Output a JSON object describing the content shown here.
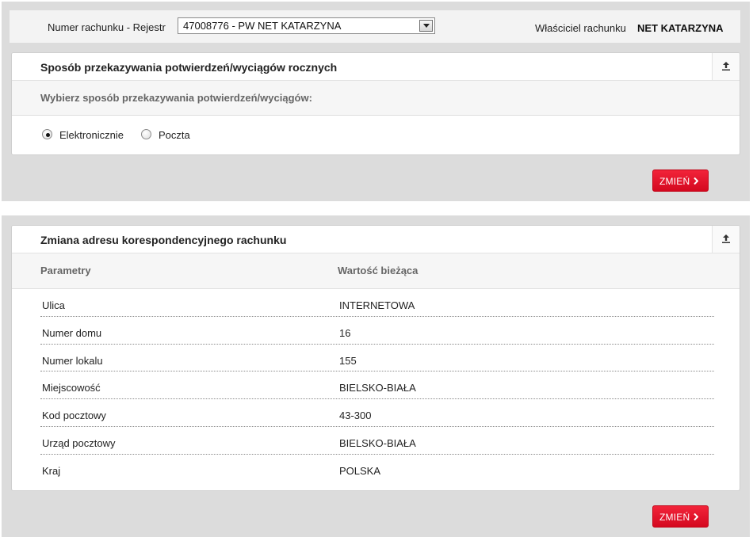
{
  "account_bar": {
    "account_label": "Numer rachunku - Rejestr",
    "account_selected": "47008776 - PW NET KATARZYNA",
    "owner_label": "Właściciel rachunku",
    "owner_value": "NET KATARZYNA"
  },
  "delivery_panel": {
    "title": "Sposób przekazywania potwierdzeń/wyciągów rocznych",
    "subtitle": "Wybierz sposób przekazywania potwierdzeń/wyciągów:",
    "options": [
      {
        "label": "Elektronicznie",
        "selected": true
      },
      {
        "label": "Poczta",
        "selected": false
      }
    ],
    "change_button": "ZMIEŃ"
  },
  "address_panel": {
    "title": "Zmiana adresu korespondencyjnego rachunku",
    "columns": [
      "Parametry",
      "Wartość bieżąca"
    ],
    "rows": [
      {
        "param": "Ulica",
        "value": "INTERNETOWA"
      },
      {
        "param": "Numer domu",
        "value": "16"
      },
      {
        "param": "Numer lokalu",
        "value": "155"
      },
      {
        "param": "Miejscowość",
        "value": "BIELSKO-BIAŁA"
      },
      {
        "param": "Kod pocztowy",
        "value": "43-300"
      },
      {
        "param": "Urząd pocztowy",
        "value": "BIELSKO-BIAŁA"
      },
      {
        "param": "Kraj",
        "value": "POLSKA"
      }
    ],
    "change_button": "ZMIEŃ"
  },
  "icons": {
    "collapse": "collapse-up-icon",
    "dropdown": "dropdown-arrow-icon",
    "button_arrow": "chevron-right-icon"
  },
  "colors": {
    "accent": "#e0102a",
    "background": "#dcdcdc"
  }
}
